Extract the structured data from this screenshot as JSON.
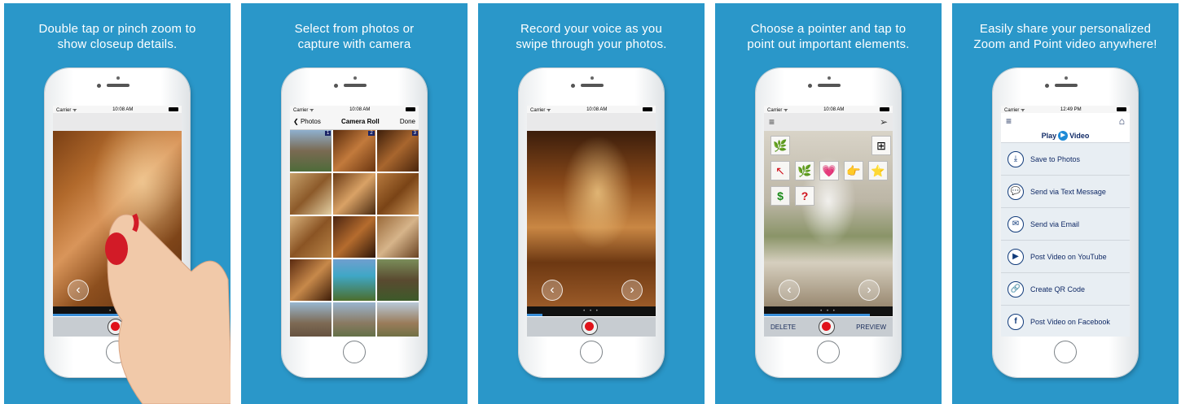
{
  "panels": [
    {
      "caption": "Double tap or pinch zoom to\nshow closeup details.",
      "status": {
        "carrier": "Carrier ᯤ",
        "time": "10:08 AM"
      }
    },
    {
      "caption": "Select from photos or\ncapture with camera",
      "status": {
        "carrier": "Carrier ᯤ",
        "time": "10:08 AM"
      },
      "nav": {
        "back": "Photos",
        "title": "Camera Roll",
        "done": "Done"
      },
      "badges": [
        "1",
        "2",
        "3"
      ]
    },
    {
      "caption": "Record your voice as you\nswipe through your photos.",
      "status": {
        "carrier": "Carrier ᯤ",
        "time": "10:08 AM"
      }
    },
    {
      "caption": "Choose a pointer and tap to\npoint out important elements.",
      "status": {
        "carrier": "Carrier ᯤ",
        "time": "10:08 AM"
      },
      "toolbar": {
        "delete": "DELETE",
        "preview": "PREVIEW"
      },
      "pointers": [
        "🌿",
        "⊞",
        "↖",
        "🌿",
        "💗",
        "👉",
        "⭐",
        "$",
        "?"
      ]
    },
    {
      "caption": "Easily share your personalized\nZoom and Point video anywhere!",
      "status": {
        "carrier": "Carrier ᯤ",
        "time": "12:49 PM"
      },
      "play_label_1": "Play",
      "play_label_2": "Video",
      "share_items": [
        {
          "label": "Save to Photos",
          "icon": "⤓"
        },
        {
          "label": "Send via Text Message",
          "icon": "💬"
        },
        {
          "label": "Send via Email",
          "icon": "✉"
        },
        {
          "label": "Post Video on YouTube",
          "icon": "▶"
        },
        {
          "label": "Create QR Code",
          "icon": "🔗"
        },
        {
          "label": "Post Video on Facebook",
          "icon": "f"
        }
      ]
    }
  ],
  "colors": {
    "panel_bg": "#2a97c9",
    "record_red": "#e0121a",
    "nav_blue": "#1a2466"
  }
}
